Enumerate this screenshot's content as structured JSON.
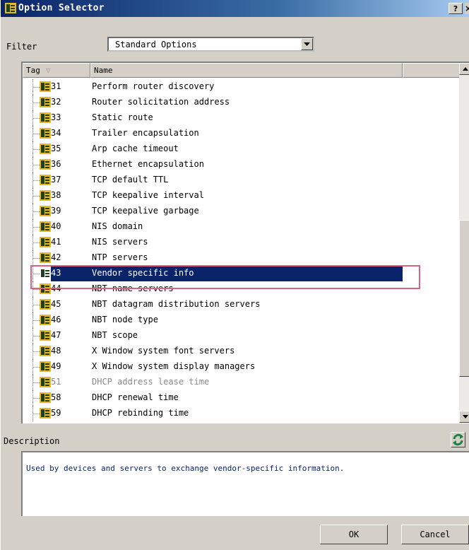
{
  "window": {
    "title": "Option Selector",
    "help_label": "?"
  },
  "filter": {
    "label": "Filter",
    "value": "Standard Options"
  },
  "list": {
    "columns": {
      "tag": "Tag",
      "name": "Name"
    },
    "rows": [
      {
        "tag": "31",
        "name": "Perform router discovery"
      },
      {
        "tag": "32",
        "name": "Router solicitation address"
      },
      {
        "tag": "33",
        "name": "Static route"
      },
      {
        "tag": "34",
        "name": "Trailer encapsulation"
      },
      {
        "tag": "35",
        "name": "Arp cache timeout"
      },
      {
        "tag": "36",
        "name": "Ethernet encapsulation"
      },
      {
        "tag": "37",
        "name": "TCP default TTL"
      },
      {
        "tag": "38",
        "name": "TCP keepalive interval"
      },
      {
        "tag": "39",
        "name": "TCP keepalive garbage"
      },
      {
        "tag": "40",
        "name": "NIS domain"
      },
      {
        "tag": "41",
        "name": "NIS servers"
      },
      {
        "tag": "42",
        "name": "NTP servers"
      },
      {
        "tag": "43",
        "name": "Vendor specific info",
        "selected": true
      },
      {
        "tag": "44",
        "name": "NBT name servers"
      },
      {
        "tag": "45",
        "name": "NBT datagram distribution servers"
      },
      {
        "tag": "46",
        "name": "NBT node type"
      },
      {
        "tag": "47",
        "name": "NBT scope"
      },
      {
        "tag": "48",
        "name": "X Window system font servers"
      },
      {
        "tag": "49",
        "name": "X Window system display managers"
      },
      {
        "tag": "51",
        "name": "DHCP address lease time",
        "disabled": true
      },
      {
        "tag": "58",
        "name": "DHCP renewal time"
      },
      {
        "tag": "59",
        "name": "DHCP rebinding time"
      }
    ]
  },
  "description": {
    "label": "Description",
    "text": "Used by devices and servers to exchange vendor-specific information."
  },
  "buttons": {
    "ok": "OK",
    "cancel": "Cancel"
  },
  "colors": {
    "title_bar": "#0a246a",
    "selection": "#0a246a",
    "highlight_box": "#e06080",
    "description_text": "#0a246a"
  },
  "icons": {
    "option": "option-icon",
    "refresh": "refresh-icon"
  }
}
